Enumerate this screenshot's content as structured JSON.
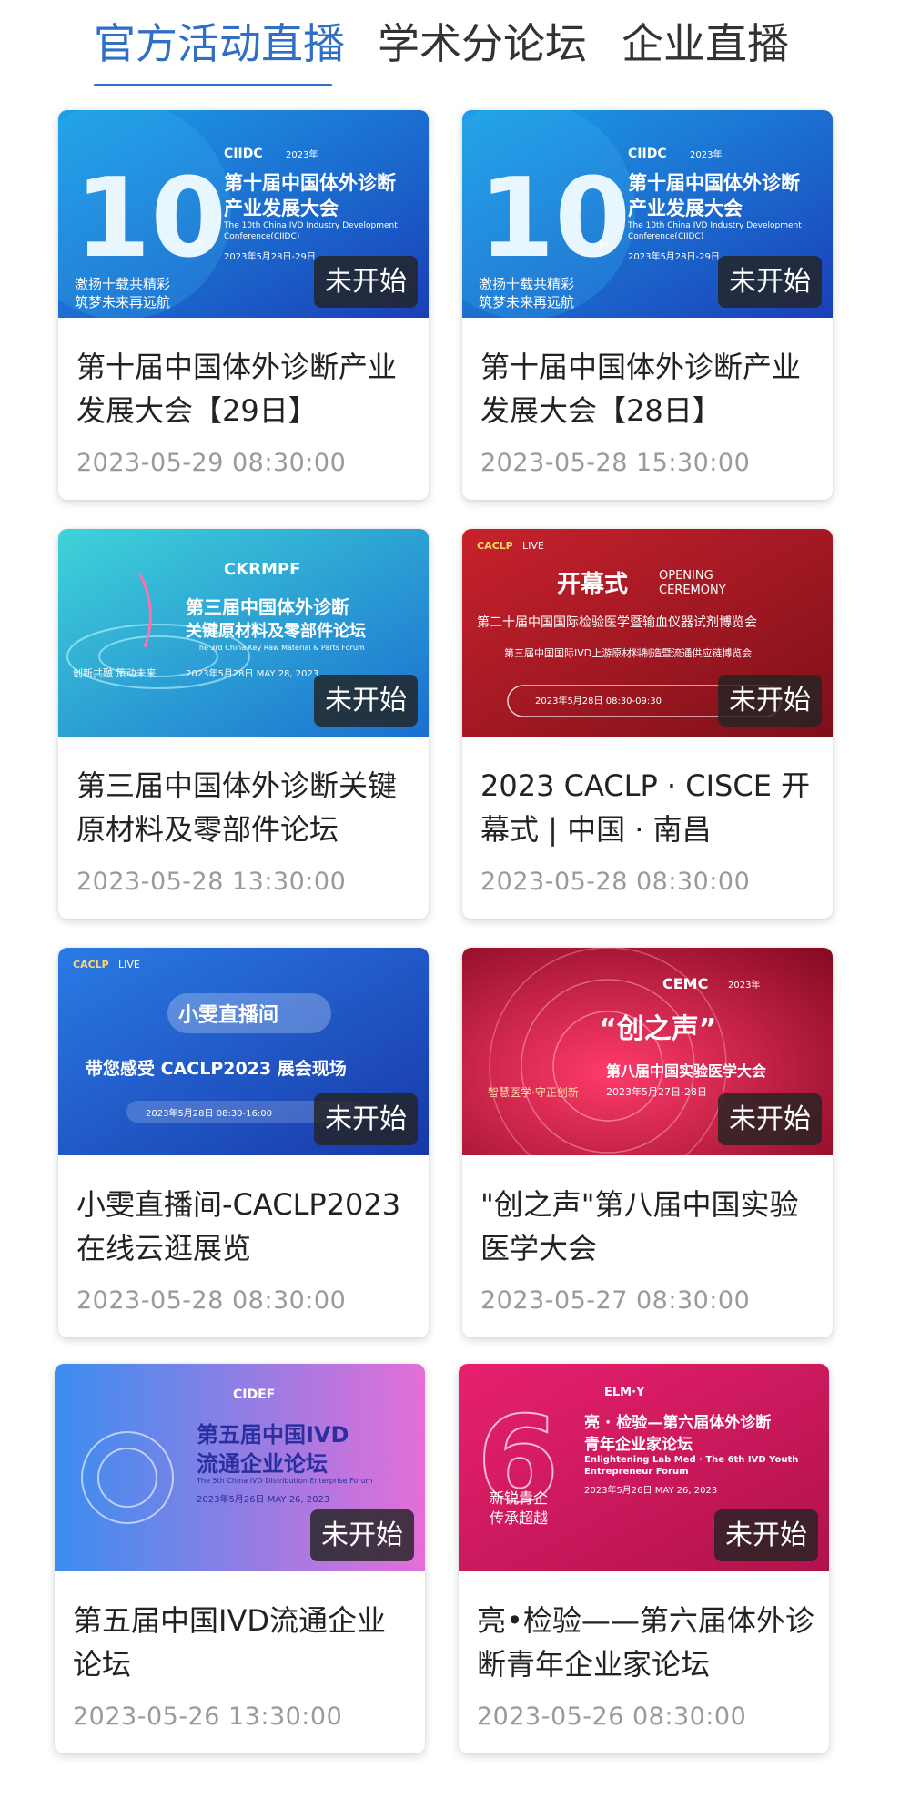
{
  "tabs": [
    {
      "label": "官方活动直播",
      "active": true
    },
    {
      "label": "学术分论坛",
      "active": false
    },
    {
      "label": "企业直播",
      "active": false
    }
  ],
  "colors": {
    "accent": "#2f6fc6",
    "badge_bg": "#232323",
    "time_text": "#9a9a9a"
  },
  "cards": [
    {
      "title": "第十届中国体外诊断产业发展大会【29日】",
      "time": "2023-05-29 08:30:00",
      "status": "未开始",
      "banner": {
        "logo": "CIIDC",
        "year": "2023年",
        "heading": "第十届中国体外诊断",
        "heading2": "产业发展大会",
        "sub": "The 10th China IVD Industry Development",
        "sub2": "Conference(CIIDC)",
        "date": "2023年5月28日-29日",
        "slogan1": "激扬十载共精彩",
        "slogan2": "筑梦未来再远航"
      }
    },
    {
      "title": "第十届中国体外诊断产业发展大会【28日】",
      "time": "2023-05-28 15:30:00",
      "status": "未开始",
      "banner": {
        "logo": "CIIDC",
        "year": "2023年",
        "heading": "第十届中国体外诊断",
        "heading2": "产业发展大会",
        "sub": "The 10th China IVD Industry Development",
        "sub2": "Conference(CIIDC)",
        "date": "2023年5月28日-29日",
        "slogan1": "激扬十载共精彩",
        "slogan2": "筑梦未来再远航"
      }
    },
    {
      "title": "第三届中国体外诊断关键原材料及零部件论坛",
      "time": "2023-05-28 13:30:00",
      "status": "未开始",
      "banner": {
        "logo": "CKRMPF",
        "heading": "第三届中国体外诊断",
        "heading2": "关键原材料及零部件论坛",
        "sub": "The 3rd China Key Raw Material & Parts Forum",
        "slogan": "创新共融 策动未来",
        "date": "2023年5月28日 MAY 28, 2023"
      }
    },
    {
      "title": "2023 CACLP · CISCE 开幕式 | 中国 · 南昌",
      "time": "2023-05-28 08:30:00",
      "status": "未开始",
      "banner": {
        "logo": "CACLP",
        "live": "LIVE",
        "heading": "开幕式",
        "en1": "OPENING",
        "en2": "CEREMONY",
        "line1": "第二十届中国国际检验医学暨输血仪器试剂博览会",
        "line2": "第三届中国国际IVD上游原材料制造暨流通供应链博览会",
        "date": "2023年5月28日 08:30-09:30"
      }
    },
    {
      "title": "小雯直播间-CACLP2023在线云逛展览",
      "time": "2023-05-28 08:30:00",
      "status": "未开始",
      "banner": {
        "logo": "CACLP",
        "live": "LIVE",
        "heading": "小雯直播间",
        "heading2": "带您感受 CACLP2023 展会现场",
        "date": "2023年5月28日 08:30-16:00"
      }
    },
    {
      "title": "\"创之声\"第八届中国实验医学大会",
      "time": "2023-05-27 08:30:00",
      "status": "未开始",
      "banner": {
        "logo": "CEMC",
        "year": "2023年",
        "heading": "“创之声”",
        "heading2": "第八届中国实验医学大会",
        "slogan": "智慧医学·守正创新",
        "date": "2023年5月27日-28日"
      }
    },
    {
      "title": "第五届中国IVD流通企业论坛",
      "time": "2023-05-26 13:30:00",
      "status": "未开始",
      "banner": {
        "logo": "CIDEF",
        "heading": "第五届中国IVD",
        "heading2": "流通企业论坛",
        "sub": "The 5th China IVD Distribution Enterprise Forum",
        "date": "2023年5月26日 MAY 26, 2023"
      }
    },
    {
      "title": "亮•检验——第六届体外诊断青年企业家论坛",
      "time": "2023-05-26 08:30:00",
      "status": "未开始",
      "banner": {
        "logo": "ELM·Y",
        "heading": "亮 · 检验—第六届体外诊断",
        "heading2": "青年企业家论坛",
        "sub": "Enlightening Lab Med · The 6th IVD Youth",
        "sub2": "Entrepreneur Forum",
        "date": "2023年5月26日 MAY 26, 2023",
        "slogan1": "新锐青企",
        "slogan2": "传承超越"
      }
    }
  ]
}
